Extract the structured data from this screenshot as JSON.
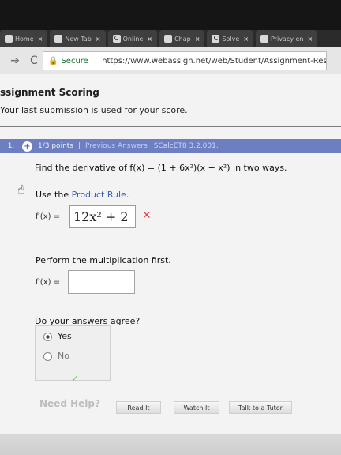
{
  "tabs": [
    {
      "icon": "",
      "label": "Home",
      "close": "×"
    },
    {
      "icon": "",
      "label": "New Tab",
      "close": "×"
    },
    {
      "icon": "C",
      "label": "Online",
      "close": "×"
    },
    {
      "icon": "",
      "label": "Chap",
      "close": "×"
    },
    {
      "icon": "C",
      "label": "Solve",
      "close": "×"
    },
    {
      "icon": "",
      "label": "Privacy en",
      "close": "×"
    }
  ],
  "address": {
    "secure": "Secure",
    "url": "https://www.webassign.net/web/Student/Assignment-Responses"
  },
  "page": {
    "score_title": "ssignment Scoring",
    "score_note": "Your last submission is used for your score.",
    "question_number": "1.",
    "points": "1/3 points",
    "previous_answers": "Previous Answers",
    "problem_code": "SCalcET8 3.2.001.",
    "task": "Find the derivative of f(x) = (1 + 6x²)(x − x²) in two ways.",
    "use_prefix": "Use the ",
    "use_link": "Product Rule",
    "use_suffix": ".",
    "fprime_label": "f′(x) =",
    "answer1": "12x² + 2",
    "perform": "Perform the multiplication first.",
    "fprime2_label": "f′(x) =",
    "agree": "Do your answers agree?",
    "yes": "Yes",
    "no": "No",
    "need_help": "Need Help?",
    "read": "Read It",
    "watch": "Watch It",
    "tutor": "Talk to a Tutor"
  },
  "colors": {
    "accent": "#6d7fc1",
    "error": "#e44848",
    "link": "#3c5db5"
  }
}
